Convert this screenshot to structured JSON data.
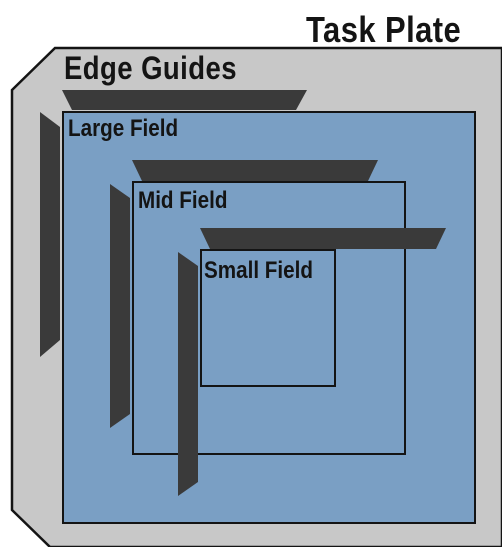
{
  "title": "Task Plate",
  "guides_label": "Edge Guides",
  "fields": {
    "large": "Large Field",
    "mid": "Mid Field",
    "small": "Small Field"
  },
  "colors": {
    "plate_fill": "#c8c8c8",
    "plate_stroke": "#141414",
    "field_fill": "#7a9fc4",
    "field_stroke": "#141414",
    "guide_fill": "#3a3a3a",
    "text": "#141414"
  }
}
